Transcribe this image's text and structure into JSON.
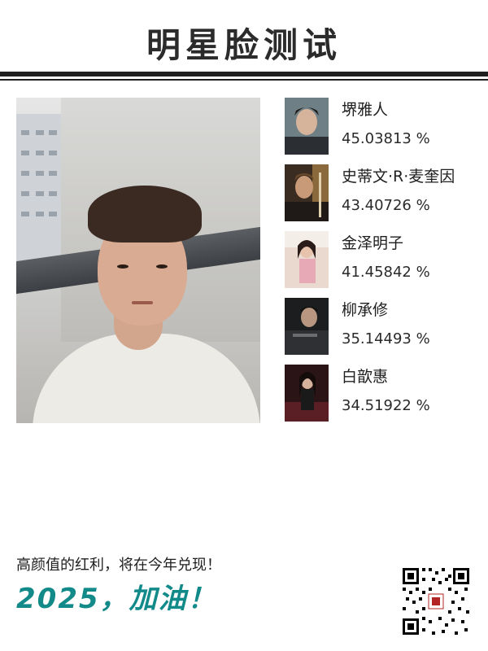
{
  "header": {
    "title": "明星脸测试"
  },
  "matches": [
    {
      "name": "堺雅人",
      "score": "45.03813 %"
    },
    {
      "name": "史蒂文·R·麦奎因",
      "score": "43.40726 %"
    },
    {
      "name": "金泽明子",
      "score": "41.45842 %"
    },
    {
      "name": "柳承修",
      "score": "35.14493 %"
    },
    {
      "name": "白歆惠",
      "score": "34.51922 %"
    }
  ],
  "footer": {
    "line": "高颜值的红利，将在今年兑现！",
    "slogan": "2025，加油！"
  },
  "colors": {
    "title": "#2b2b2b",
    "rule": "#1f1f1f",
    "slogan": "#138a8a"
  }
}
